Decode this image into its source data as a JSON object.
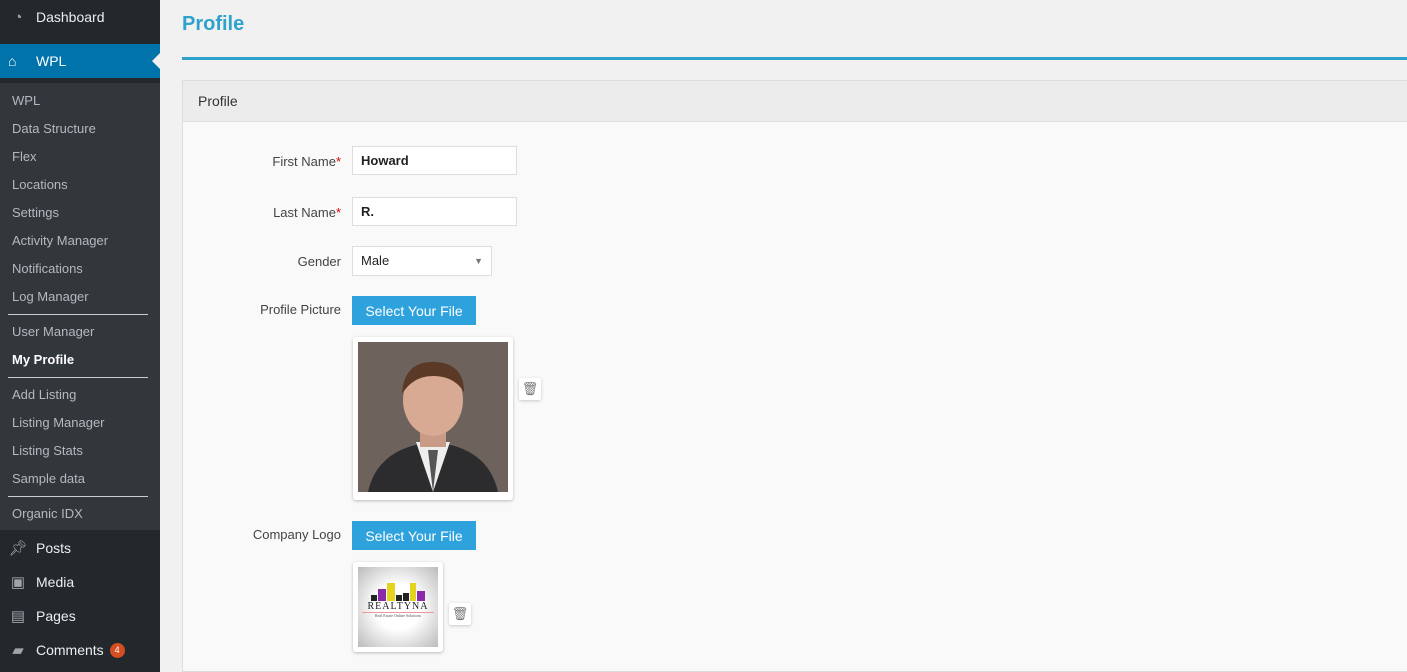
{
  "sidebar": {
    "dashboard": "Dashboard",
    "wpl": "WPL",
    "sub_items": [
      "WPL",
      "Data Structure",
      "Flex",
      "Locations",
      "Settings",
      "Activity Manager",
      "Notifications",
      "Log Manager"
    ],
    "sub_items2": [
      "User Manager",
      "My Profile"
    ],
    "sub_items3": [
      "Add Listing",
      "Listing Manager",
      "Listing Stats",
      "Sample data"
    ],
    "sub_items4": [
      "Organic IDX"
    ],
    "bottom": [
      {
        "label": "Posts",
        "icon": "pin-icon"
      },
      {
        "label": "Media",
        "icon": "media-icon"
      },
      {
        "label": "Pages",
        "icon": "pages-icon"
      },
      {
        "label": "Comments",
        "icon": "comment-icon",
        "badge": "4"
      }
    ],
    "active": "My Profile"
  },
  "page": {
    "title": "Profile",
    "panel_title": "Profile"
  },
  "form": {
    "first_name_label": "First Name",
    "first_name": "Howard",
    "last_name_label": "Last Name",
    "last_name": "R.",
    "required": "*",
    "gender_label": "Gender",
    "gender": "Male",
    "profile_picture_label": "Profile Picture",
    "select_file": "Select Your File",
    "company_logo_label": "Company Logo",
    "logo_text": "REALTYNA",
    "logo_tagline": "Real Estate Online Solutions"
  },
  "colors": {
    "accent": "#2ea2cc",
    "active_menu": "#0073aa",
    "sidebar": "#23282d",
    "badge": "#d54e21"
  }
}
